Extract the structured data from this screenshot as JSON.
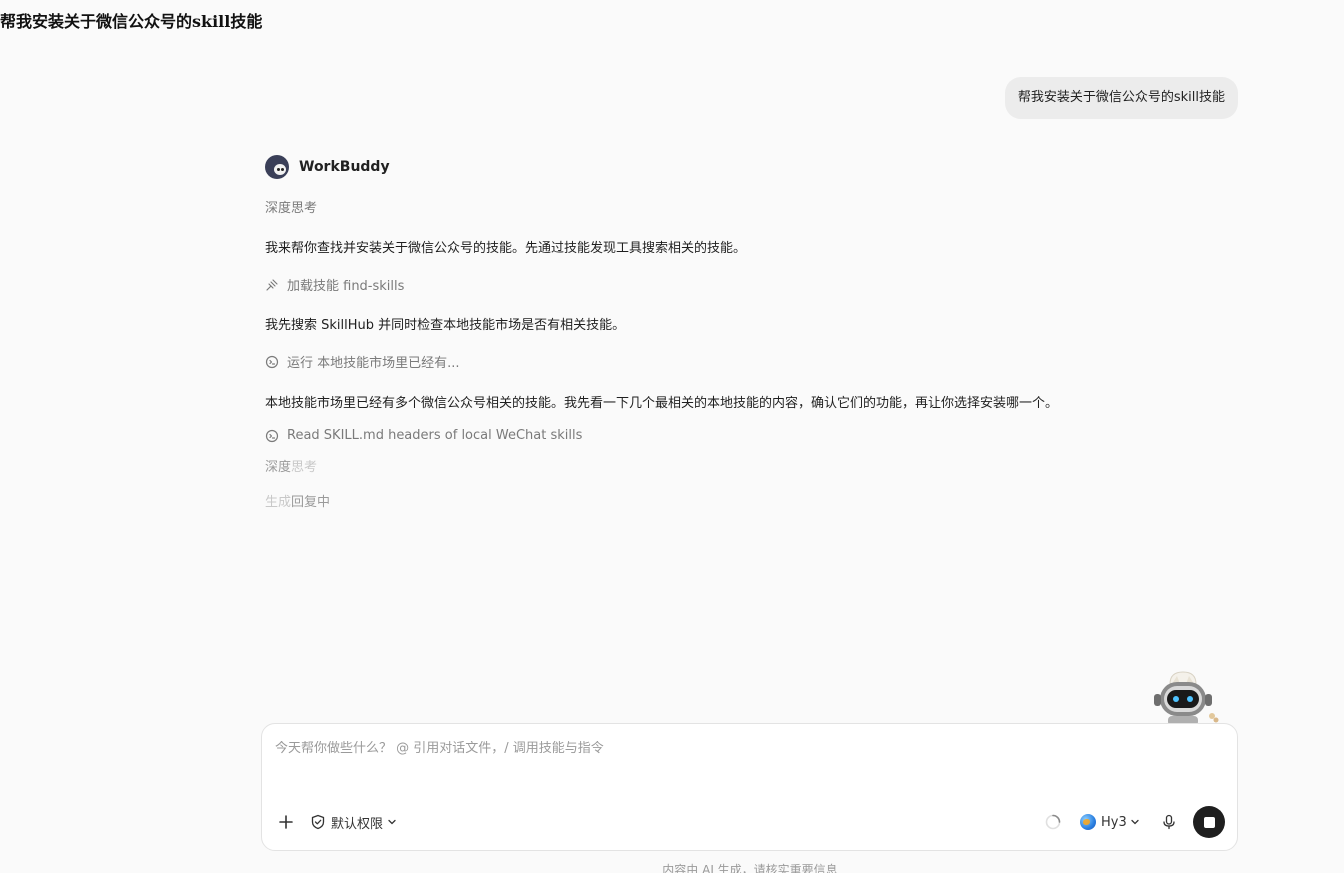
{
  "page_title": "帮我安装关于微信公众号的skill技能",
  "user_message": "帮我安装关于微信公众号的skill技能",
  "assistant": {
    "name": "WorkBuddy",
    "thinking_1": "深度思考",
    "paragraph_1": "我来帮你查找并安装关于微信公众号的技能。先通过技能发现工具搜索相关的技能。",
    "tool_1": "加载技能 find-skills",
    "paragraph_2": "我先搜索 SkillHub 并同时检查本地技能市场是否有相关技能。",
    "tool_2": "运行 本地技能市场里已经有...",
    "paragraph_3": "本地技能市场里已经有多个微信公众号相关的技能。我先看一下几个最相关的本地技能的内容，确认它们的功能，再让你选择安装哪一个。",
    "tool_3": "Read SKILL.md headers of local WeChat skills",
    "thinking_2_a": "深度",
    "thinking_2_b": "思考",
    "status_a": "生成",
    "status_b": "回复中"
  },
  "composer": {
    "placeholder": "今天帮你做些什么？ @ 引用对话文件，/ 调用技能与指令",
    "permission_label": "默认权限",
    "model_label": "Hy3"
  },
  "disclaimer": "内容由 AI 生成，请核实重要信息",
  "icons": {
    "add": "plus-icon",
    "permission": "shield-check-icon",
    "chevron": "chevron-down-icon",
    "loading": "spinner-icon",
    "model": "globe-icon",
    "mic": "microphone-icon",
    "stop": "stop-icon",
    "skill": "skill-icon",
    "terminal": "terminal-icon"
  },
  "colors": {
    "background": "#fafafa",
    "bubble": "#ececec",
    "stop_button": "#1f1f1f"
  }
}
